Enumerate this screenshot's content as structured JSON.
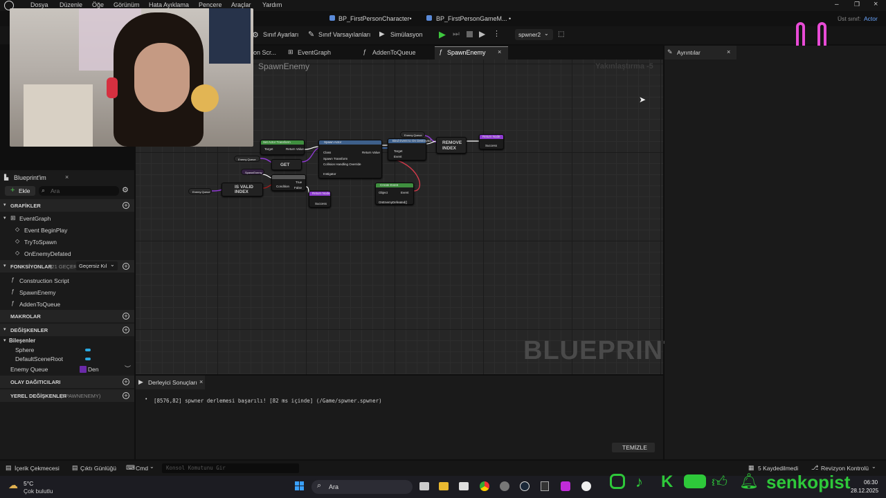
{
  "menu": [
    "Dosya",
    "Düzenle",
    "Öğe",
    "Görünüm",
    "Hata Ayıklama",
    "Pencere",
    "Araçlar",
    "Yardım"
  ],
  "document_tabs": [
    "BP_FirstPersonCharacter•",
    "BP_FirstPersonGameM... •"
  ],
  "parent_class": {
    "label": "Üst sınıf:",
    "value": "Actor"
  },
  "toolbar": {
    "class_settings": "Sınıf Ayarları",
    "class_defaults": "Sınıf Varsayılanları",
    "simulation": "Simülasyon",
    "debug_object": "spwner2"
  },
  "graph_tabs": [
    "on Scr...",
    "EventGraph",
    "AddenToQueue",
    "SpawnEnemy"
  ],
  "graph": {
    "title": "SpawnEnemy",
    "zoom": "Yakınlaştırma -5",
    "watermark": "BLUEPRINT",
    "nodes": {
      "get": "GET",
      "is_valid_index": "IS VALID INDEX",
      "remove_index": "REMOVE INDEX",
      "enemy_queue_1": "Enemy Queue",
      "enemy_queue_2": "Enemy Queue",
      "enemy_queue_3": "Enemy Queue",
      "return_node_1": "Return Node",
      "return_node_2": "Return Node",
      "success_1": "Success",
      "success_2": "Success",
      "spawn_actor": "Spawn Actor",
      "set_actor_transform": "Set Actor Transform",
      "bind_event": "Bind Event to On Destroyed",
      "create_event": "Create Event",
      "target": "Target",
      "return_value": "Return Value",
      "class": "Class",
      "spawn_transform": "Spawn Transform",
      "collision": "Collision Handling Override",
      "instigator": "Instigator",
      "event": "Event",
      "condition": "Condition",
      "true_label": "True",
      "false_label": "False",
      "object": "Object",
      "on_enemy_defeated": "OnEnemyDefeated()",
      "spawn_enemy_ref": "SpawnEnemy"
    }
  },
  "details_panel": {
    "title": "Ayrıntılar"
  },
  "my_blueprint": {
    "title": "Blueprint'im",
    "add_label": "Ekle",
    "search_placeholder": "Ara",
    "graphs_header": "GRAFİKLER",
    "event_graph": "EventGraph",
    "events": [
      "Event BeginPlay",
      "TryToSpawn",
      "OnEnemyDefated"
    ],
    "functions_header": "FONKSİYONLAR",
    "functions_count": "(21 GEÇERS",
    "override_label": "Geçersiz Kıl",
    "functions": [
      "Construction Script",
      "SpawnEnemy",
      "AddenToQueue"
    ],
    "macros_header": "MAKROLAR",
    "variables_header": "DEĞİŞKENLER",
    "components_header": "Bileşenler",
    "components": [
      "Sphere",
      "DefaultSceneRoot"
    ],
    "enemy_queue_label": "Enemy Queue",
    "enemy_queue_type": "Den",
    "dispatchers_header": "OLAY DAĞITICILARI",
    "locals_header": "YEREL DEĞİŞKENLER",
    "locals_sub": "(SPAWNENEMY)"
  },
  "compiler": {
    "tab": "Derleyici Sonuçları",
    "message": "[8576,82] spwner derlemesi başarılı! [82 ms içinde] (/Game/spwner.spwner)",
    "clear_button": "TEMİZLE"
  },
  "statusbar": {
    "content_drawer": "İçerik Çekmecesi",
    "output_log": "Çıktı Günlüğü",
    "cmd": "Cmd",
    "console_placeholder": "Konsol Komutunu Gir",
    "saved": "5 Kaydedilmedi",
    "revision": "Revizyon Kontrolü"
  },
  "taskbar": {
    "weather_temp": "5°C",
    "weather_desc": "Çok bulutlu",
    "search": "Ara",
    "time": "06:30",
    "date": "28.12.2025"
  },
  "overlay": {
    "brand": "senkopist"
  },
  "colors": {
    "accent_pink": "#e84bd6",
    "social_green": "#2ec83a",
    "node_green": "#3f8f3f",
    "node_blue": "#3d5f8a",
    "pin_purple": "#8e3ad0",
    "exec_red": "#d03a4a"
  }
}
